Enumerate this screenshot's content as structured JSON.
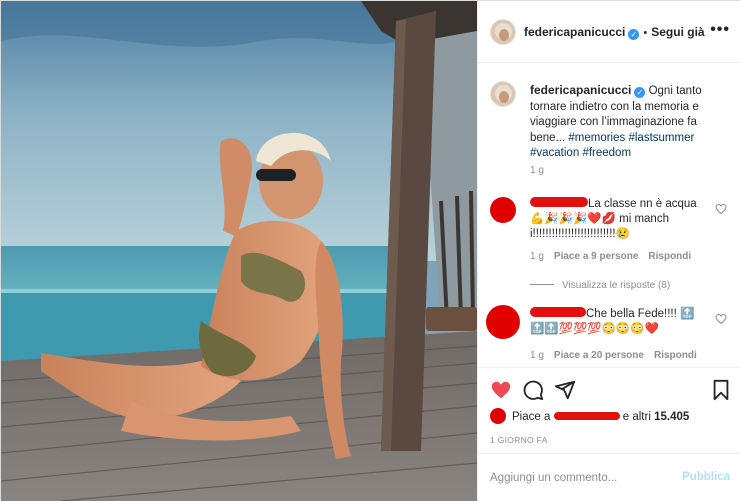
{
  "header": {
    "username": "federicapanicucci",
    "verified": true,
    "separator": "•",
    "follow_label": "Segui già",
    "more_label": "•••"
  },
  "caption": {
    "username": "federicapanicucci",
    "text": "Ogni tanto tornare indietro con la memoria e viaggiare con l’immaginazione fa bene...",
    "hashtags": [
      "#memories",
      "#lastsummer",
      "#vacation",
      "#freedom"
    ],
    "time": "1 g"
  },
  "comments": [
    {
      "text": "La classe nn è acqua",
      "emojis": "💪🎉🎉🎉❤️💋",
      "text2": "mi manchi!!!!!!!!!!!!!!!!!!!!!!!!!!",
      "emoji_end": "😢",
      "time": "1 g",
      "likes": "Piace a 9 persone",
      "reply": "Rispondi"
    },
    {
      "text": "Che bella Fede!!!!",
      "emojis": "🔝🔝🔝💯💯💯😳😳😳❤️",
      "time": "1 g",
      "likes": "Piace a 20 persone",
      "reply": "Rispondi"
    }
  ],
  "view_replies": "Visualizza le risposte (8)",
  "likes": {
    "prefix": "Piace a",
    "suffix": "e altri",
    "count": "15.405"
  },
  "date": "1 GIORNO FA",
  "add_comment": {
    "placeholder": "Aggiungi un commento...",
    "publish_label": "Pubblica"
  },
  "colors": {
    "accent_blue": "#3897f0",
    "hashtag": "#00376b",
    "like_red": "#ed4956",
    "meta_gray": "#8e8e8e",
    "redaction_red": "#e31010"
  },
  "icons": [
    "heart-icon",
    "comment-icon",
    "share-icon",
    "bookmark-icon",
    "more-icon",
    "verified-icon"
  ]
}
